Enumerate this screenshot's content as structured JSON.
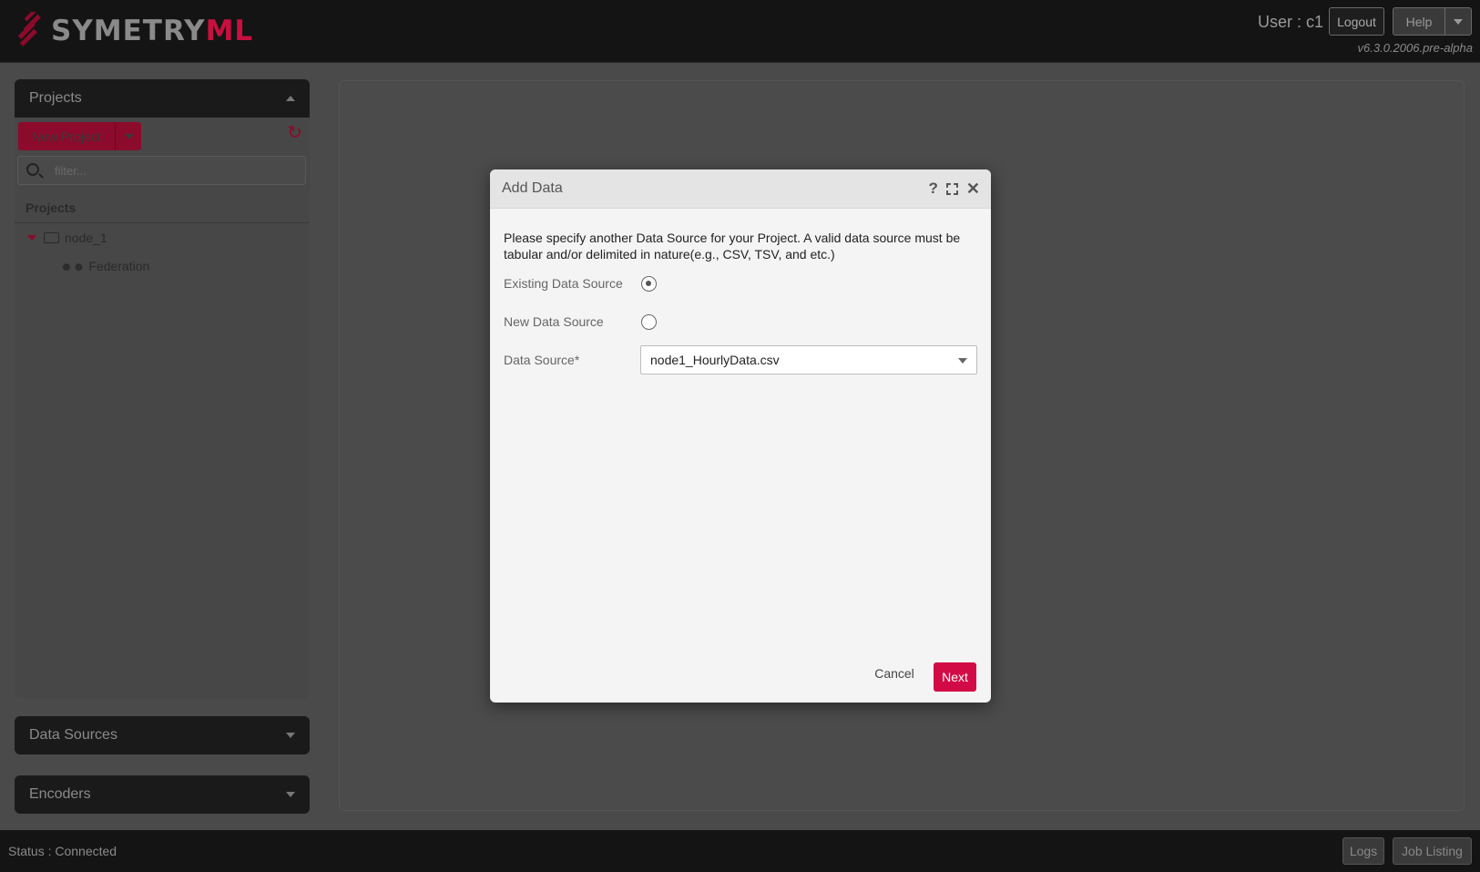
{
  "header": {
    "logo_main": "SYMETRY",
    "logo_accent": "ML",
    "user_label": "User : c1",
    "logout_label": "Logout",
    "help_label": "Help",
    "version": "v6.3.0.2006.pre-alpha"
  },
  "sidebar": {
    "projects_title": "Projects",
    "new_project_label": "New Project",
    "filter_placeholder": "filter...",
    "tree_header": "Projects",
    "tree_node": "node_1",
    "tree_child": "Federation",
    "data_sources_title": "Data Sources",
    "encoders_title": "Encoders"
  },
  "dialog": {
    "title": "Add Data",
    "description": "Please specify another Data Source for your Project. A valid data source must be tabular and/or delimited in nature(e.g., CSV, TSV, and etc.)",
    "existing_label": "Existing Data Source",
    "new_label": "New Data Source",
    "source_label": "Data Source*",
    "source_value": "node1_HourlyData.csv",
    "cancel_label": "Cancel",
    "next_label": "Next"
  },
  "statusbar": {
    "status": "Status : Connected",
    "logs_label": "Logs",
    "jobs_label": "Job Listing"
  },
  "colors": {
    "brand": "#c8103e",
    "primary_button": "#d20b46",
    "header_bg": "#141414"
  }
}
